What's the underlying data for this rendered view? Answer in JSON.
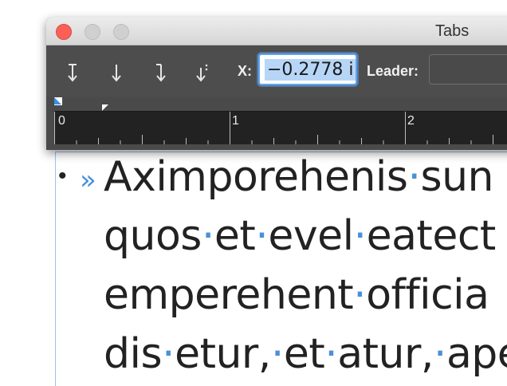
{
  "window": {
    "title": "Tabs"
  },
  "toolbar": {
    "tab_buttons": [
      {
        "name": "left-justified-tab-icon"
      },
      {
        "name": "center-justified-tab-icon"
      },
      {
        "name": "right-justified-tab-icon"
      },
      {
        "name": "align-on-character-tab-icon"
      }
    ],
    "x_label": "X:",
    "x_value": "−0.2778 i",
    "leader_label": "Leader:",
    "leader_value": ""
  },
  "ruler": {
    "labels": [
      "0",
      "1",
      "2"
    ]
  },
  "document": {
    "bullet": "•",
    "tab_marker": "»",
    "lines": [
      [
        "Aximporehenis",
        "sun"
      ],
      [
        "quos",
        "et",
        "evel",
        "eatect"
      ],
      [
        "emperehent",
        "officia"
      ],
      [
        "dis",
        "etur,",
        "et",
        "atur,",
        "ape"
      ]
    ],
    "separator": "·"
  },
  "colors": {
    "accent": "#4a90d9",
    "close": "#fc5f57",
    "palette_bg": "#4a4a4a",
    "ruler_bg": "#222222"
  }
}
